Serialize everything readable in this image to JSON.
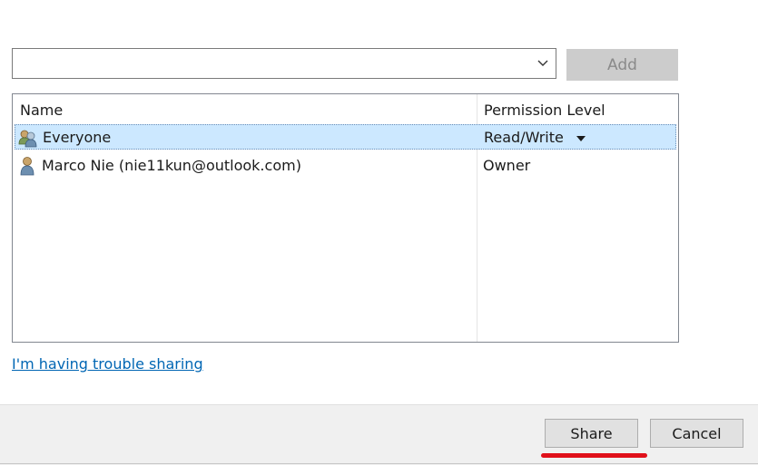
{
  "dialog": {
    "people_input": {
      "value": "",
      "placeholder": ""
    },
    "add_button_label": "Add",
    "list": {
      "columns": [
        "Name",
        "Permission Level"
      ],
      "rows": [
        {
          "name": "Everyone",
          "permission": "Read/Write",
          "icon": "group-users-icon",
          "selected": true
        },
        {
          "name": "Marco Nie (nie11kun@outlook.com)",
          "permission": "Owner",
          "icon": "user-icon",
          "selected": false
        }
      ]
    },
    "trouble_link": "I'm having trouble sharing"
  },
  "footer": {
    "share_label": "Share",
    "cancel_label": "Cancel"
  },
  "colors": {
    "selection": "#cce8ff",
    "link": "#0066b4",
    "annotation": "#e0101a"
  }
}
